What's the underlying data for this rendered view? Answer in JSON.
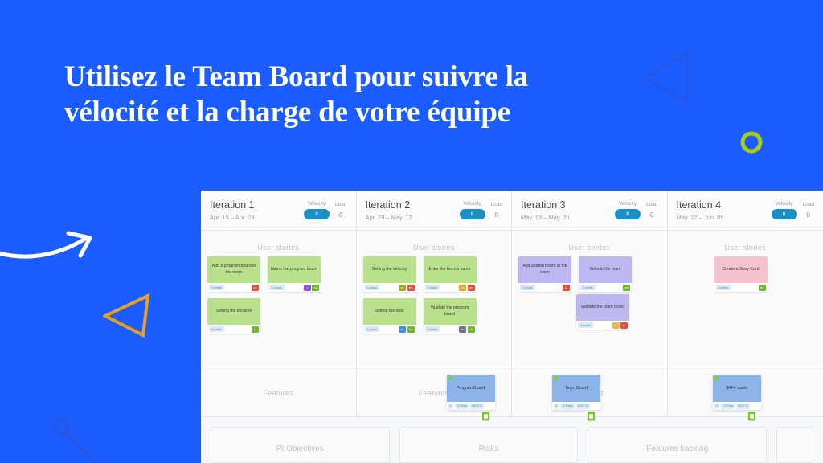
{
  "headline": {
    "line1": "Utilisez le Team Board pour suivre la",
    "line2": "vélocité et la charge de votre équipe"
  },
  "colors": {
    "background": "#1A5CFF",
    "headline_text": "#FFFFFF",
    "velocity_pill": "#1B8FC4",
    "story_green": "#B9E08A",
    "story_purple": "#BDB6F0",
    "story_pink": "#F4C2CE",
    "feature_blue": "#8CB4E8",
    "accent_green": "#7ED321",
    "accent_orange": "#E8A020"
  },
  "board": {
    "zone_labels": {
      "user_stories": "User stories",
      "features": "Features"
    },
    "metric_labels": {
      "velocity": "Velocity",
      "load": "Load"
    },
    "iterations": [
      {
        "name": "Iteration 1",
        "dates": "Apr. 15 – Apr. 28",
        "velocity": "8",
        "load": "0",
        "stories": [
          {
            "title": "Add a program board in the room",
            "points": "2 points",
            "color": "green",
            "chips": [
              {
                "label": "LG",
                "color": "#E0503A"
              }
            ]
          },
          {
            "title": "Name the program board",
            "points": "1 points",
            "color": "green",
            "chips": [
              {
                "label": "=",
                "color": "#9B4FD0"
              },
              {
                "label": "AA",
                "color": "#6FB82E"
              }
            ]
          },
          {
            "title": "Setting the iteration",
            "points": "3 points",
            "color": "green",
            "chips": [
              {
                "label": "AA",
                "color": "#6FB82E"
              }
            ]
          }
        ],
        "feature": null
      },
      {
        "name": "Iteration 2",
        "dates": "Apr. 29 – May. 12",
        "velocity": "8",
        "load": "0",
        "stories": [
          {
            "title": "Setting the velocity",
            "points": "2 points",
            "color": "green",
            "chips": [
              {
                "label": "AA",
                "color": "#A8A524"
              },
              {
                "label": "MN",
                "color": "#E0503A"
              }
            ]
          },
          {
            "title": "Enter the team's name",
            "points": "2 points",
            "color": "green",
            "chips": [
              {
                "label": "CB",
                "color": "#E8A020"
              },
              {
                "label": "AA",
                "color": "#E0503A"
              }
            ]
          },
          {
            "title": "Setting the date",
            "points": "1 points",
            "color": "green",
            "chips": [
              {
                "label": "KB",
                "color": "#3B8FD4"
              },
              {
                "label": "NH",
                "color": "#6FB82E"
              }
            ]
          },
          {
            "title": "Validate the program board",
            "points": "2 points",
            "color": "green",
            "chips": [
              {
                "label": "BM",
                "color": "#6E7480"
              },
              {
                "label": "AM",
                "color": "#6FB82E"
              }
            ]
          }
        ],
        "feature": {
          "title": "Program Board",
          "tags": [
            "H",
            "12 Points",
            "WSJF 12"
          ]
        }
      },
      {
        "name": "Iteration 3",
        "dates": "May. 13 – May. 26",
        "velocity": "8",
        "load": "0",
        "stories": [
          {
            "title": "Add a team board in the room",
            "points": "2 points",
            "color": "purple",
            "chips": [
              {
                "label": "FL",
                "color": "#E0503A"
              }
            ]
          },
          {
            "title": "Validate the team board",
            "points": "3 points",
            "color": "purple",
            "chips": [
              {
                "label": "□",
                "color": "#E8B84B"
              },
              {
                "label": "KL",
                "color": "#E0503A"
              }
            ]
          },
          {
            "title": "Selecte the team",
            "points": "2 points",
            "color": "purple",
            "chips": [
              {
                "label": "GM",
                "color": "#6FB82E"
              }
            ]
          }
        ],
        "feature": {
          "title": "Team Board",
          "tags": [
            "H",
            "12 Points",
            "WSJF 12"
          ]
        }
      },
      {
        "name": "Iteration 4",
        "dates": "May. 27 – Jun. 09",
        "velocity": "8",
        "load": "0",
        "stories": [
          {
            "title": "Create a Story Card",
            "points": "3 points",
            "color": "pink",
            "chips": [
              {
                "label": "RL",
                "color": "#6FB82E"
              }
            ]
          }
        ],
        "feature": {
          "title": "SAFe cards",
          "tags": [
            "H",
            "12 Points",
            "WSJF 12"
          ]
        }
      }
    ],
    "bottom_panels": [
      {
        "label": "PI Objectives"
      },
      {
        "label": "Risks"
      },
      {
        "label": "Features backlog"
      },
      {
        "label": ""
      }
    ]
  }
}
